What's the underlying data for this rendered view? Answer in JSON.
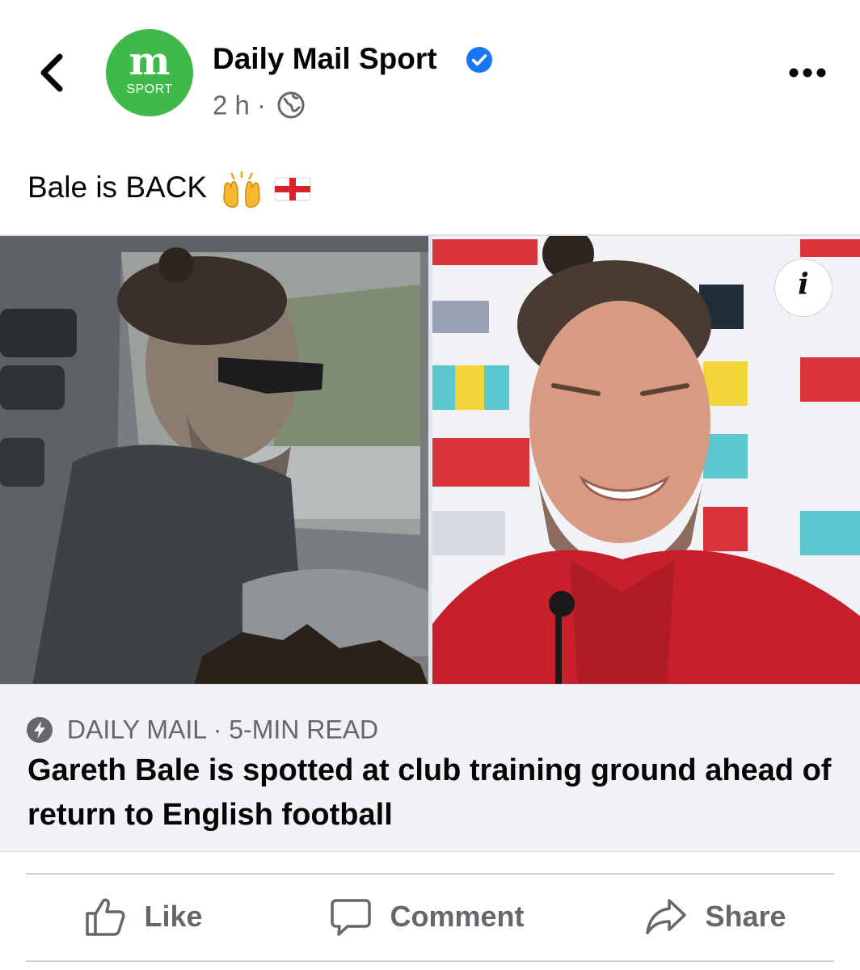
{
  "post": {
    "page_name": "Daily Mail Sport",
    "avatar_logo_letter": "m",
    "avatar_logo_text": "SPORT",
    "time": "2 h",
    "separator": "·",
    "caption": "Bale is BACK",
    "verified_icon": "verified-badge-icon",
    "audience_icon": "globe-icon"
  },
  "link_preview": {
    "source": "DAILY MAIL · 5-MIN READ",
    "title": "Gareth Bale is spotted at club training ground ahead of return to English football",
    "info_label": "i"
  },
  "actions": {
    "like": "Like",
    "comment": "Comment",
    "share": "Share"
  },
  "colors": {
    "brand_green": "#3fb94a",
    "verified_blue": "#1877f2",
    "secondary_text": "#65676b"
  }
}
